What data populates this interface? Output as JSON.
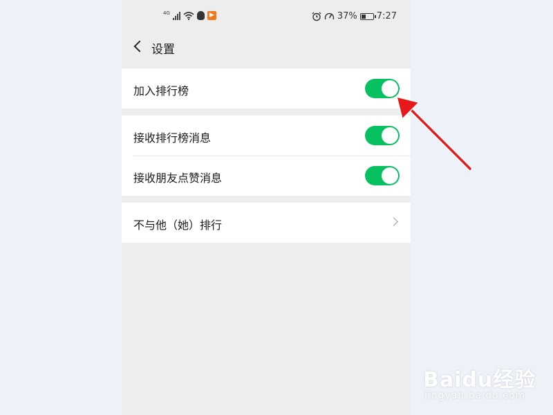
{
  "status_bar": {
    "network_type": "4G",
    "battery_percent": "37%",
    "battery_level": 0.37,
    "time": "7:27",
    "icons": [
      "signal-icon",
      "wifi-icon",
      "qq-icon",
      "video-app-icon",
      "alarm-icon",
      "data-speed-icon",
      "battery-icon"
    ]
  },
  "nav": {
    "title": "设置"
  },
  "settings": {
    "join_ranking": {
      "label": "加入排行榜",
      "enabled": true
    },
    "receive_ranking_messages": {
      "label": "接收排行榜消息",
      "enabled": true
    },
    "receive_friend_likes": {
      "label": "接收朋友点赞消息",
      "enabled": true
    },
    "exclude_from_ranking": {
      "label": "不与他（她）排行"
    }
  },
  "watermark": {
    "logo": "Baidu经验",
    "url": "jingyan.baidu.com"
  },
  "colors": {
    "toggle_on": "#07c160",
    "annotation_arrow": "#e8191b",
    "page_bg": "#ededed"
  }
}
